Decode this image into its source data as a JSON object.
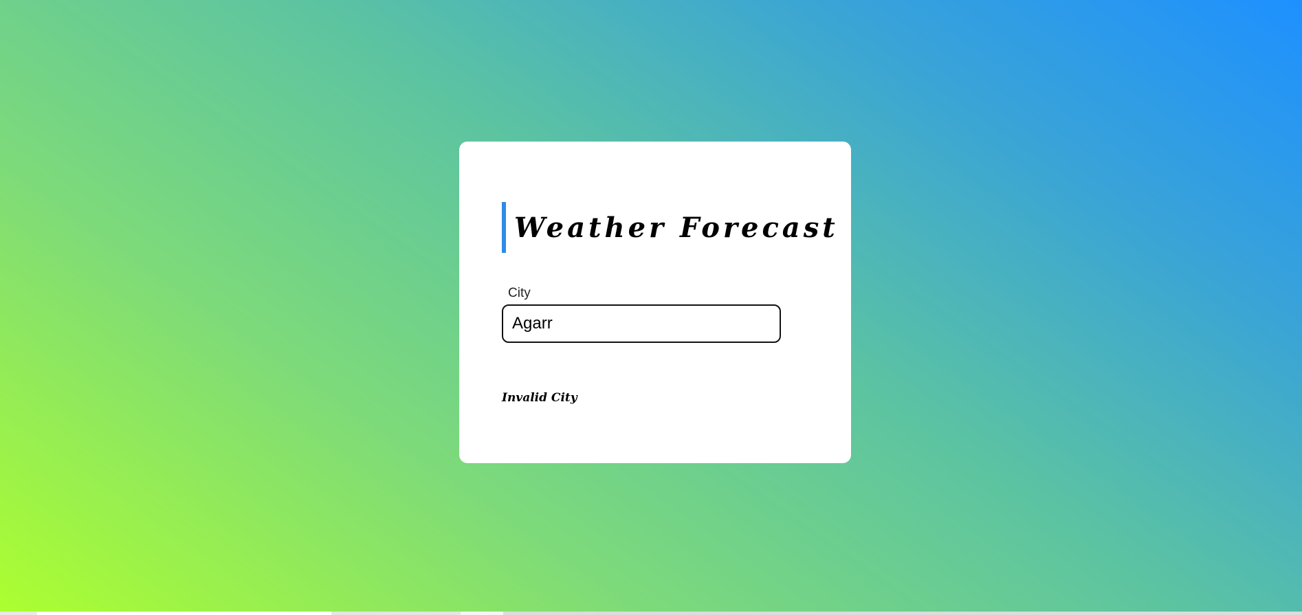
{
  "theme": {
    "accent": "#2f8be6",
    "gradient_start": "#adff2f",
    "gradient_end": "#1e90ff"
  },
  "card": {
    "title": "Weather Forecast",
    "city_label": "City",
    "city_value": "Agarr",
    "status_message": "Invalid City"
  }
}
